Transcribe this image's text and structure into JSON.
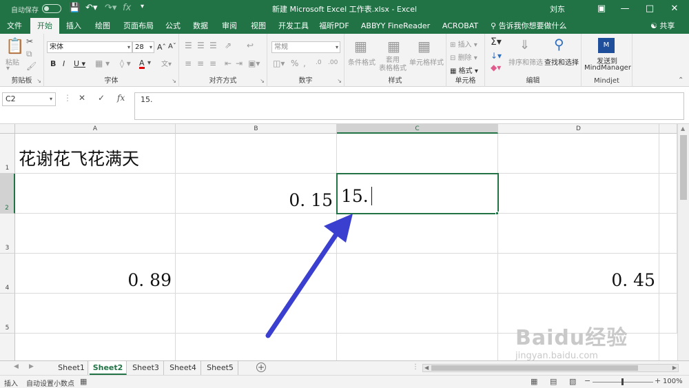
{
  "titlebar": {
    "autosave": "自动保存",
    "title": "新建 Microsoft Excel 工作表.xlsx  -  Excel",
    "user": "刘东",
    "accent": "#217346"
  },
  "tabs": [
    "文件",
    "开始",
    "插入",
    "绘图",
    "页面布局",
    "公式",
    "数据",
    "审阅",
    "视图",
    "开发工具",
    "福昕PDF",
    "ABBYY FineReader 12",
    "ACROBAT"
  ],
  "tell_me": "告诉我你想要做什么",
  "share": "共享",
  "ribbon": {
    "clipboard": {
      "paste": "粘贴",
      "label": "剪贴板"
    },
    "font": {
      "name": "宋体",
      "size": "28",
      "label": "字体"
    },
    "alignment": {
      "label": "对齐方式"
    },
    "number": {
      "format": "常规",
      "label": "数字"
    },
    "styles": {
      "conditional": "条件格式",
      "table": "套用\n表格格式",
      "cell_styles": "单元格样式",
      "label": "样式"
    },
    "cells": {
      "insert": "插入",
      "delete": "删除",
      "format": "格式",
      "label": "单元格"
    },
    "editing": {
      "sort": "排序和筛选",
      "find": "查找和选择",
      "label": "编辑"
    },
    "mindjet": {
      "send": "发送到",
      "app": "MindManager",
      "label": "Mindjet"
    }
  },
  "formula_bar": {
    "name_box": "C2",
    "formula": "15."
  },
  "grid": {
    "columns": [
      "A",
      "B",
      "C",
      "D"
    ],
    "rows": [
      "1",
      "2",
      "3",
      "4",
      "5"
    ],
    "cells": {
      "A1": "花谢花飞花满天",
      "B2": "0. 15",
      "C2": "15.",
      "A4": "0. 89",
      "D4": "0. 45"
    },
    "active_cell": "C2"
  },
  "sheets": [
    "Sheet1",
    "Sheet2",
    "Sheet3",
    "Sheet4",
    "Sheet5"
  ],
  "active_sheet": "Sheet2",
  "status": {
    "mode": "插入",
    "info": "自动设置小数点",
    "zoom": "100%"
  },
  "watermark": {
    "logo": "Baidu经验",
    "url": "jingyan.baidu.com"
  }
}
